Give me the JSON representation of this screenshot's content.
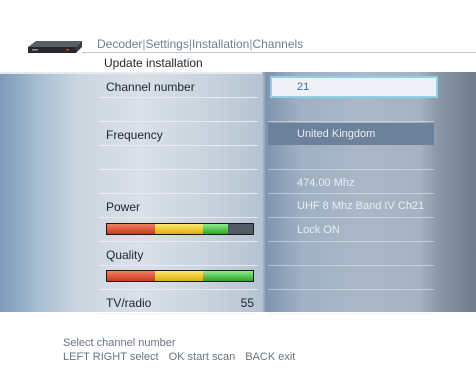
{
  "header": {
    "breadcrumb": [
      "Decoder",
      "Settings",
      "Installation",
      "Channels"
    ],
    "menu_title": "Update installation"
  },
  "fields": {
    "channel_number": {
      "label": "Channel number",
      "value": "21"
    },
    "frequency": {
      "label": "Frequency",
      "value": "United Kingdom"
    },
    "frequency_mhz": "474.00 Mhz",
    "band": "UHF 8 Mhz Band IV Ch21",
    "lock_status": "Lock ON",
    "power": {
      "label": "Power",
      "level": 0.83
    },
    "quality": {
      "label": "Quality",
      "level": 1.0
    },
    "tv_radio": {
      "label": "TV/radio",
      "value": "55"
    }
  },
  "footer": {
    "hint": "Select channel number",
    "keys": [
      "LEFT RIGHT select",
      "OK start scan",
      "BACK exit"
    ]
  },
  "colors": {
    "highlight_border": "#8fd0e4",
    "channel_value": "#3d6fa5",
    "bar_red": "#c83b20",
    "bar_yellow": "#d8b10a",
    "bar_green": "#2ea22a"
  }
}
